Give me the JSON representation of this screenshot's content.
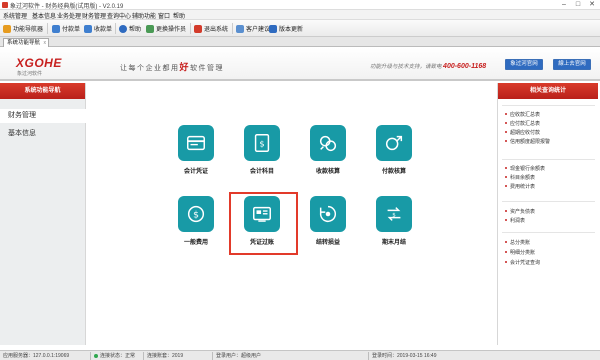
{
  "titlebar": {
    "title": "象过河软件 - 财务经典版(试用版) - V2.0.19",
    "minimize": "–",
    "maximize": "□",
    "close": "✕"
  },
  "menubar": {
    "items": [
      "系统管理",
      "基本信息",
      "业务处理",
      "财务管理",
      "查询中心",
      "辅助功能",
      "窗口",
      "帮助"
    ]
  },
  "toolbar": {
    "items": [
      {
        "label": "功能导航器",
        "color": "#e69b1f",
        "icon": "home-icon"
      },
      {
        "label": "付款单",
        "color": "#3f7fcf",
        "icon": "payment-icon"
      },
      {
        "label": "收款单",
        "color": "#3f7fcf",
        "icon": "receipt-icon"
      },
      {
        "label": "帮助",
        "color": "#2f6bc0",
        "icon": "help-icon"
      },
      {
        "label": "更换操作员",
        "color": "#4a9a55",
        "icon": "user-switch-icon"
      },
      {
        "label": "退出系统",
        "color": "#d33b2b",
        "icon": "exit-icon"
      },
      {
        "label": "客户建议",
        "color": "#5a8fcf",
        "icon": "feedback-icon"
      },
      {
        "label": "版本更新",
        "color": "#2f6bc0",
        "icon": "update-icon"
      }
    ]
  },
  "tabbar": {
    "tab_label": "系统功能导航",
    "close": "x"
  },
  "banner": {
    "logo": "XGOHE",
    "logo_sub": "象过河软件",
    "slogan_pre": "让每个企业都用",
    "slogan_hl": "好",
    "slogan_post": "软件管理",
    "hotline_label": "功能升级与技术支持，请致电",
    "hotline_number": "400-600-1168",
    "btn_official": "象过河官网",
    "btn_online": "線上去官网"
  },
  "left_panel": {
    "header": "系统功能导航",
    "items": [
      "财务管理",
      "基本信息"
    ]
  },
  "functions": [
    {
      "label": "会计凭证",
      "icon": "voucher-icon"
    },
    {
      "label": "会计科目",
      "icon": "account-subject-icon"
    },
    {
      "label": "收款核算",
      "icon": "receipt-accounting-icon"
    },
    {
      "label": "付款核算",
      "icon": "payment-accounting-icon"
    },
    {
      "label": "一般费用",
      "icon": "expense-icon"
    },
    {
      "label": "凭证过账",
      "icon": "voucher-posting-icon"
    },
    {
      "label": "结转损益",
      "icon": "profit-loss-transfer-icon"
    },
    {
      "label": "期末月结",
      "icon": "month-end-close-icon"
    }
  ],
  "right_panel": {
    "header": "相关查询统计",
    "groups": [
      [
        "应收款汇总表",
        "应付款汇总表",
        "超期应收付款",
        "信用额度超限报警"
      ],
      [
        "现金银行余额表",
        "科目余额表",
        "费用统计表"
      ],
      [
        "资产负债表",
        "利润表"
      ],
      [
        "总分类账",
        "明细分类账",
        "会计凭证查询"
      ]
    ]
  },
  "statusbar": {
    "server": "应用服务器：127.0.0.1:19069",
    "connection": "连接状态：正常",
    "account": "连接账套：2019",
    "login_user": "登录用户：超级用户",
    "login_time": "登录时间：2019-03-15 16:49"
  },
  "colors": {
    "accent_red": "#c7201f",
    "tile_teal": "#189aa6",
    "link_blue": "#2f6bc0"
  }
}
